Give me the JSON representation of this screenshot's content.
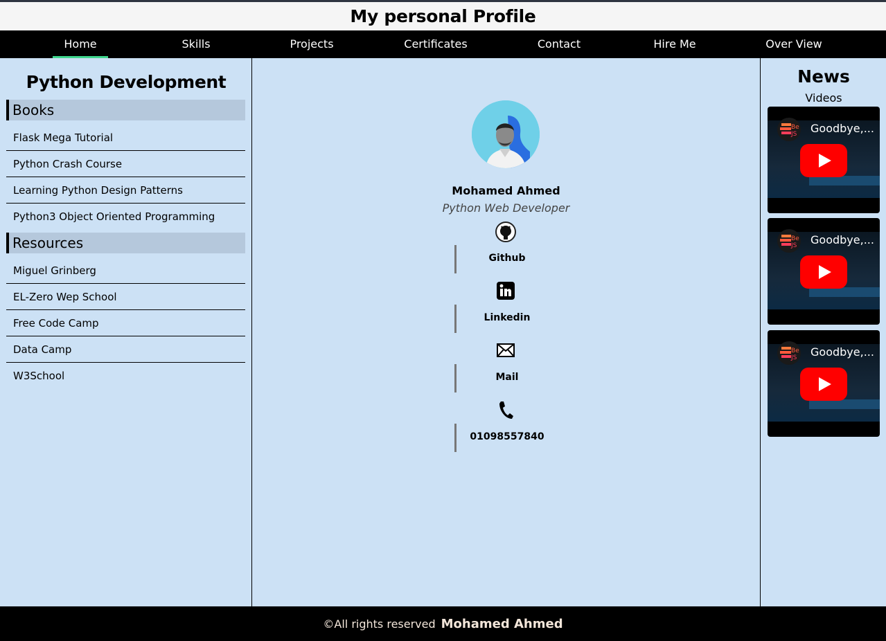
{
  "header": {
    "title": "My personal Profile"
  },
  "nav": {
    "items": [
      "Home",
      "Skills",
      "Projects",
      "Certificates",
      "Contact",
      "Hire Me",
      "Over View"
    ],
    "active": "Home"
  },
  "sidebar": {
    "title": "Python Development",
    "books": {
      "heading": "Books",
      "items": [
        "Flask Mega Tutorial",
        "Python Crash Course",
        "Learning Python Design Patterns",
        "Python3 Object Oriented Programming"
      ]
    },
    "resources": {
      "heading": "Resources",
      "items": [
        "Miguel Grinberg",
        "EL-Zero Wep School",
        "Free Code Camp",
        "Data Camp",
        "W3School"
      ]
    }
  },
  "profile": {
    "name": "Mohamed Ahmed",
    "role": "Python Web Developer",
    "contacts": [
      {
        "label": "Github",
        "icon": "github-icon"
      },
      {
        "label": "Linkedin",
        "icon": "linkedin-icon"
      },
      {
        "label": "Mail",
        "icon": "mail-icon"
      },
      {
        "label": "01098557840",
        "icon": "phone-icon"
      }
    ]
  },
  "news": {
    "title": "News",
    "videos_label": "Videos",
    "videos": [
      {
        "title": "Goodbye,..."
      },
      {
        "title": "Goodbye,..."
      },
      {
        "title": "Goodbye,..."
      }
    ]
  },
  "footer": {
    "text": "©All rights reserved",
    "name": "Mohamed Ahmed"
  },
  "colors": {
    "nav_active_underline": "#3fd68c",
    "page_bg": "#cce1f5",
    "section_head_bg": "#b5c8dc",
    "youtube_red": "#ff0000"
  }
}
